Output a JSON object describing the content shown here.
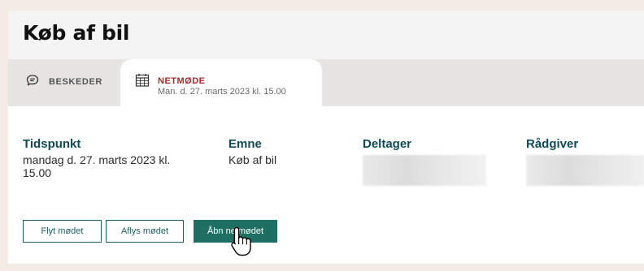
{
  "page": {
    "title": "Køb af bil"
  },
  "tabs": [
    {
      "label": "BESKEDER",
      "icon": "chat-bubble-icon"
    },
    {
      "label": "NETMØDE",
      "icon": "calendar-icon",
      "subtitle": "Man. d. 27. marts 2023 kl. 15.00",
      "active": true
    }
  ],
  "meeting": {
    "time_label": "Tidspunkt",
    "time_value": "mandag d. 27. marts 2023 kl. 15.00",
    "subject_label": "Emne",
    "subject_value": "Køb af bil",
    "participant_label": "Deltager",
    "advisor_label": "Rådgiver"
  },
  "actions": {
    "move_label": "Flyt mødet",
    "cancel_label": "Aflys mødet",
    "open_label": "Åbn netmødet"
  },
  "colors": {
    "accent": "#1f6f63",
    "label": "#0e4a55",
    "active_tab_text": "#a52a2a",
    "page_background": "#f3ece4"
  },
  "cursor": "hand-pointer-icon"
}
